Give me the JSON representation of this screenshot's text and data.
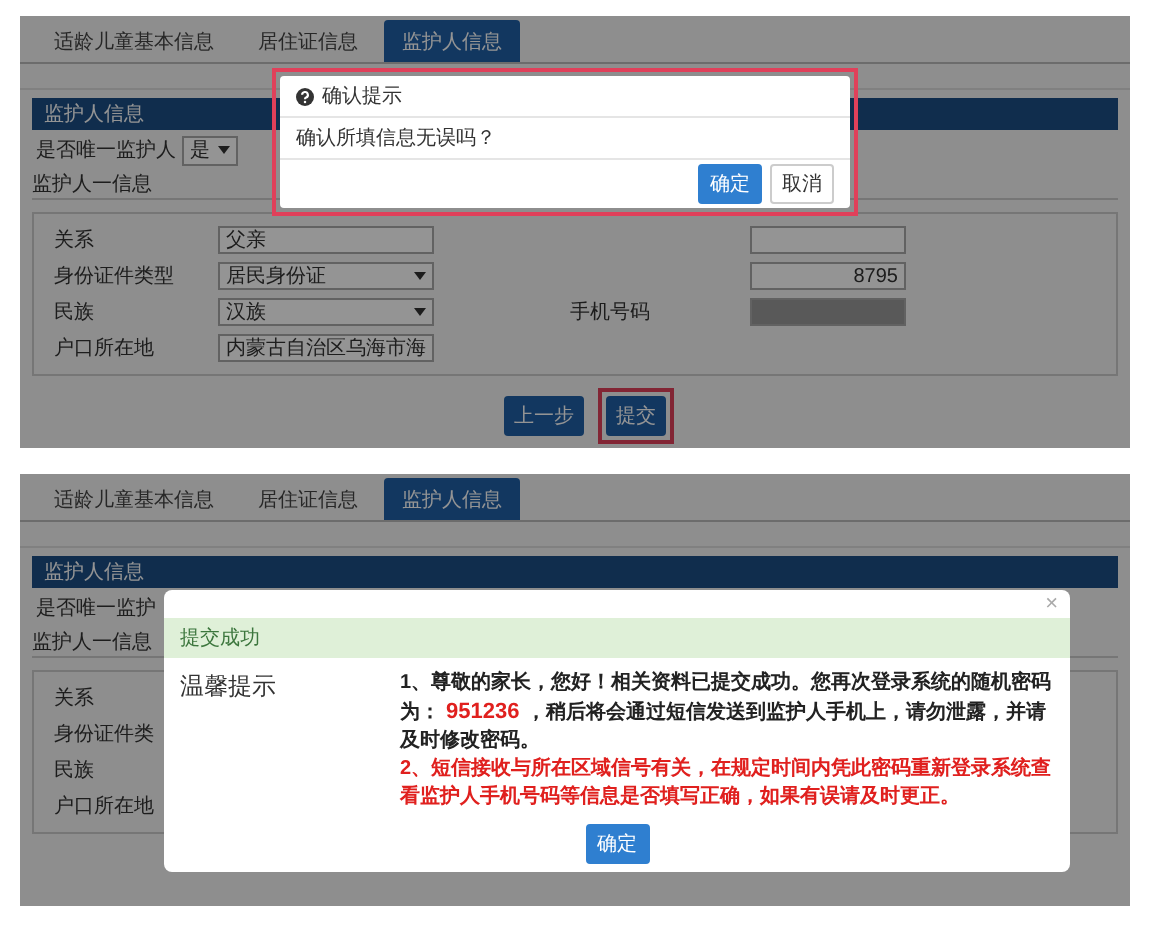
{
  "screens": [
    {
      "kind": "confirm",
      "tabs": [
        {
          "label": "适龄儿童基本信息",
          "selected": false
        },
        {
          "label": "居住证信息",
          "selected": false
        },
        {
          "label": "监护人信息",
          "selected": true
        }
      ],
      "panel_title": "监护人信息",
      "unique_guardian": {
        "label": "是否唯一监护人",
        "value": "是"
      },
      "section_label": "监护人一信息",
      "rows": [
        {
          "label": "关系",
          "value": "父亲",
          "kind": "input",
          "right": {
            "kind": "input"
          }
        },
        {
          "label": "身份证件类型",
          "value": "居民身份证",
          "kind": "select",
          "right": {
            "kind": "input",
            "value": "8795"
          }
        },
        {
          "label": "民族",
          "value": "汉族",
          "kind": "select",
          "right": {
            "label": "手机号码",
            "kind": "masked"
          }
        },
        {
          "label": "户口所在地",
          "value": "内蒙古自治区乌海市海",
          "kind": "input"
        }
      ],
      "buttons": [
        {
          "label": "上一步",
          "highlighted": false
        },
        {
          "label": "提交",
          "highlighted": true
        }
      ],
      "dialog": {
        "title": "确认提示",
        "message": "确认所填信息无误吗？",
        "highlighted": true,
        "buttons": [
          {
            "label": "确定",
            "kind": "primary"
          },
          {
            "label": "取消",
            "kind": "default"
          }
        ]
      }
    },
    {
      "kind": "notice",
      "tabs": [
        {
          "label": "适龄儿童基本信息",
          "selected": false
        },
        {
          "label": "居住证信息",
          "selected": false
        },
        {
          "label": "监护人信息",
          "selected": true
        }
      ],
      "panel_title": "监护人信息",
      "unique_guardian": {
        "label": "是否唯一监护"
      },
      "section_label": "监护人一信息",
      "rows": [
        {
          "label": "关系"
        },
        {
          "label": "身份证件类"
        },
        {
          "label": "民族"
        },
        {
          "label": "户口所在地"
        }
      ],
      "dialog": {
        "close": "×",
        "status": "提交成功",
        "side_label": "温馨提示",
        "paragraphs": [
          {
            "kind": "normal",
            "segments": [
              {
                "kind": "plain",
                "text": "1、尊敬的家长，您好！相关资料已提交成功。您再次登录系统的随机密码为："
              },
              {
                "kind": "code",
                "text": " 951236 "
              },
              {
                "kind": "plain",
                "text": "，稍后将会通过短信发送到监护人手机上，请勿泄露，并请及时修改密码。"
              }
            ]
          },
          {
            "kind": "warning",
            "segments": [
              {
                "kind": "plain",
                "text": "2、短信接收与所在区域信号有关，在规定时间内凭此密码重新登录系统查看监护人手机号码等信息是否填写正确，如果有误请及时更正。"
              }
            ]
          }
        ],
        "button": "确定"
      }
    }
  ]
}
